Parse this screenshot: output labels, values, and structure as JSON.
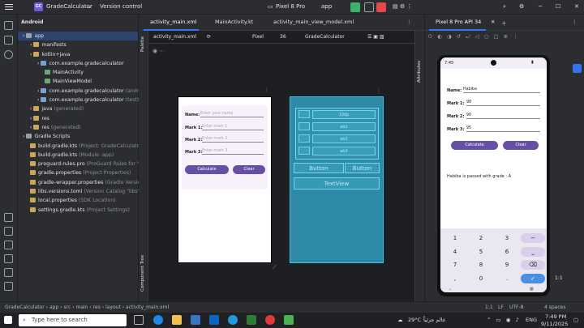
{
  "window": {
    "project_badge": "GC",
    "project_name": "GradeCalculator",
    "vcs": "Version control",
    "device": "Pixel 8 Pro",
    "run_config": "app"
  },
  "sidebar": {
    "title": "Android",
    "tree": [
      {
        "label": "app",
        "muted": "",
        "indent": 0
      },
      {
        "label": "manifests",
        "muted": "",
        "indent": 1
      },
      {
        "label": "kotlin+java",
        "muted": "",
        "indent": 1
      },
      {
        "label": "com.example.gradecalculator",
        "muted": "",
        "indent": 2
      },
      {
        "label": "MainActivity",
        "muted": "",
        "indent": 3
      },
      {
        "label": "MainViewModel",
        "muted": "",
        "indent": 3
      },
      {
        "label": "com.example.gradecalculator",
        "muted": "(androi",
        "indent": 2
      },
      {
        "label": "com.example.gradecalculator",
        "muted": "(test)",
        "indent": 2
      },
      {
        "label": "java",
        "muted": "(generated)",
        "indent": 1
      },
      {
        "label": "res",
        "muted": "",
        "indent": 1
      },
      {
        "label": "res",
        "muted": "(generated)",
        "indent": 1
      },
      {
        "label": "Gradle Scripts",
        "muted": "",
        "indent": 0
      },
      {
        "label": "build.gradle.kts",
        "muted": "(Project: GradeCalculator",
        "indent": 1
      },
      {
        "label": "build.gradle.kts",
        "muted": "(Module :app)",
        "indent": 1
      },
      {
        "label": "proguard-rules.pro",
        "muted": "(ProGuard Rules for \"",
        "indent": 1
      },
      {
        "label": "gradle.properties",
        "muted": "(Project Properties)",
        "indent": 1
      },
      {
        "label": "gradle-wrapper.properties",
        "muted": "(Gradle Versio",
        "indent": 1
      },
      {
        "label": "libs.versions.toml",
        "muted": "(Version Catalog \"libs\"",
        "indent": 1
      },
      {
        "label": "local.properties",
        "muted": "(SDK Location)",
        "indent": 1
      },
      {
        "label": "settings.gradle.kts",
        "muted": "(Project Settings)",
        "indent": 1
      }
    ]
  },
  "editor": {
    "tabs": [
      "activity_main.xml",
      "MainActivity.kt",
      "activity_main_view_model.xml"
    ],
    "toolbar": {
      "file": "activity_main.xml",
      "device": "Pixel",
      "api": "36",
      "theme": "GradeCalculator"
    },
    "palette_label": "Palette",
    "component_tree_label": "Component Tree",
    "attributes_label": "Attributes",
    "design": {
      "name_label": "Name:",
      "name_hint": "Enter your name",
      "mark1_label": "Mark 1:",
      "mark1_hint": "Enter mark 1",
      "mark2_label": "Mark 2:",
      "mark2_hint": "Enter mark 2",
      "mark3_label": "Mark 3:",
      "mark3_hint": "Enter mark 3",
      "calculate": "Calculate",
      "clear": "Clear"
    },
    "blueprint": {
      "rows": [
        "10dp",
        "ab1",
        "ab2",
        "ab3"
      ],
      "button1": "Button",
      "button2": "Button",
      "textview": "TextView"
    }
  },
  "running_devices": {
    "tab": "Pixel 8 Pro API 34",
    "status_time": "7:45",
    "app": {
      "name_label": "Name:",
      "name_value": "Habiba",
      "mark1_label": "Mark 1:",
      "mark1_value": "98",
      "mark2_label": "Mark 2:",
      "mark2_value": "90",
      "mark3_label": "Mark 3:",
      "mark3_value": "95",
      "calculate": "Calculate",
      "clear": "Clear",
      "result": "Habiba is passed with grade : A"
    },
    "keyboard": [
      "1",
      "2",
      "3",
      "−",
      "4",
      "5",
      "6",
      "⎵",
      "7",
      "8",
      "9",
      "⌫",
      ",",
      "0",
      ".",
      "✓"
    ],
    "side_label": "1:1"
  },
  "statusbar": {
    "breadcrumb": [
      "GradeCalculator",
      "app",
      "src",
      "main",
      "res",
      "layout",
      "activity_main.xml"
    ],
    "position": "1:1",
    "line_sep": "LF",
    "encoding": "UTF-8",
    "indent": "4 spaces"
  },
  "taskbar": {
    "search": "Type here to search",
    "weather": "29°C",
    "weather_city": "عالم جزئياً",
    "lang": "ENG",
    "time": "7:49 PM",
    "date": "9/11/2025"
  },
  "colors": {
    "accent": "#3574f0",
    "purple": "#6750a4",
    "run": "#3bb36b",
    "stop": "#e5484d"
  }
}
